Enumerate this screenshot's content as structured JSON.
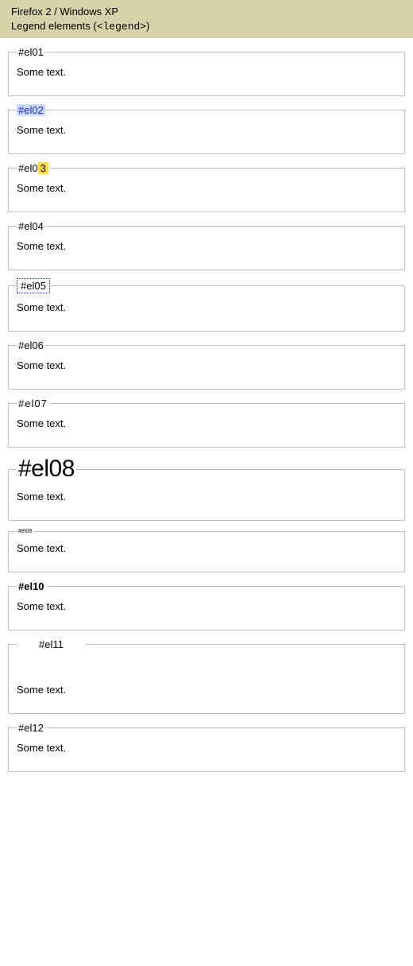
{
  "header": {
    "line1": "Firefox 2 / Windows XP",
    "line2_prefix": "Legend elements (",
    "line2_tag": "<legend>",
    "line2_suffix": ")"
  },
  "examples": {
    "e01": {
      "legend": "#el01",
      "body": "Some text."
    },
    "e02": {
      "legend": "#el02",
      "body": "Some text."
    },
    "e03": {
      "legend_pre": "#el0",
      "legend_hi": "3",
      "body": "Some text."
    },
    "e04": {
      "legend": "#el04",
      "body": "Some text."
    },
    "e05": {
      "legend": "#el05",
      "body": "Some text."
    },
    "e06": {
      "legend": "#el06",
      "body": "Some text."
    },
    "e07": {
      "legend": "#el07",
      "body": "Some text."
    },
    "e08": {
      "legend": "#el08",
      "body": "Some text."
    },
    "e09": {
      "legend": "#el09",
      "body": "Some text."
    },
    "e10": {
      "legend": "#el10",
      "body": "Some text."
    },
    "e11": {
      "legend": "#el11",
      "body": "Some text."
    },
    "e12": {
      "legend": "#el12",
      "body": "Some text."
    }
  }
}
